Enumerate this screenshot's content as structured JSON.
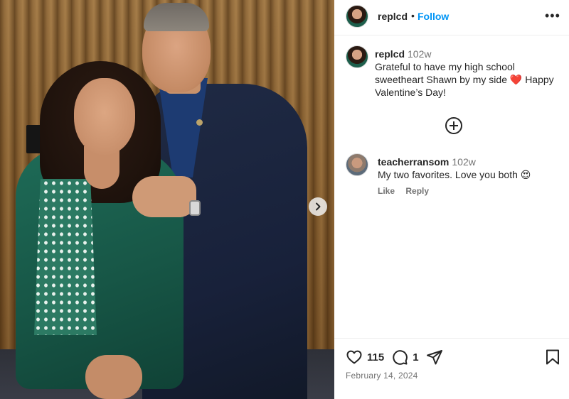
{
  "header": {
    "username": "replcd",
    "separator": "•",
    "follow_label": "Follow",
    "more_icon": "more-horizontal-icon"
  },
  "post": {
    "username": "replcd",
    "age": "102w",
    "caption": "Grateful to have my high school sweetheart Shawn by my side ❤️ Happy Valentine’s Day!"
  },
  "comments": [
    {
      "username": "teacherransom",
      "age": "102w",
      "text": "My two favorites. Love you both 😍",
      "like_label": "Like",
      "reply_label": "Reply"
    }
  ],
  "actions": {
    "likes": "115",
    "comments": "1"
  },
  "date": "February 14, 2024",
  "colors": {
    "accent": "#0095f6",
    "text": "#262626",
    "muted": "#737373"
  }
}
